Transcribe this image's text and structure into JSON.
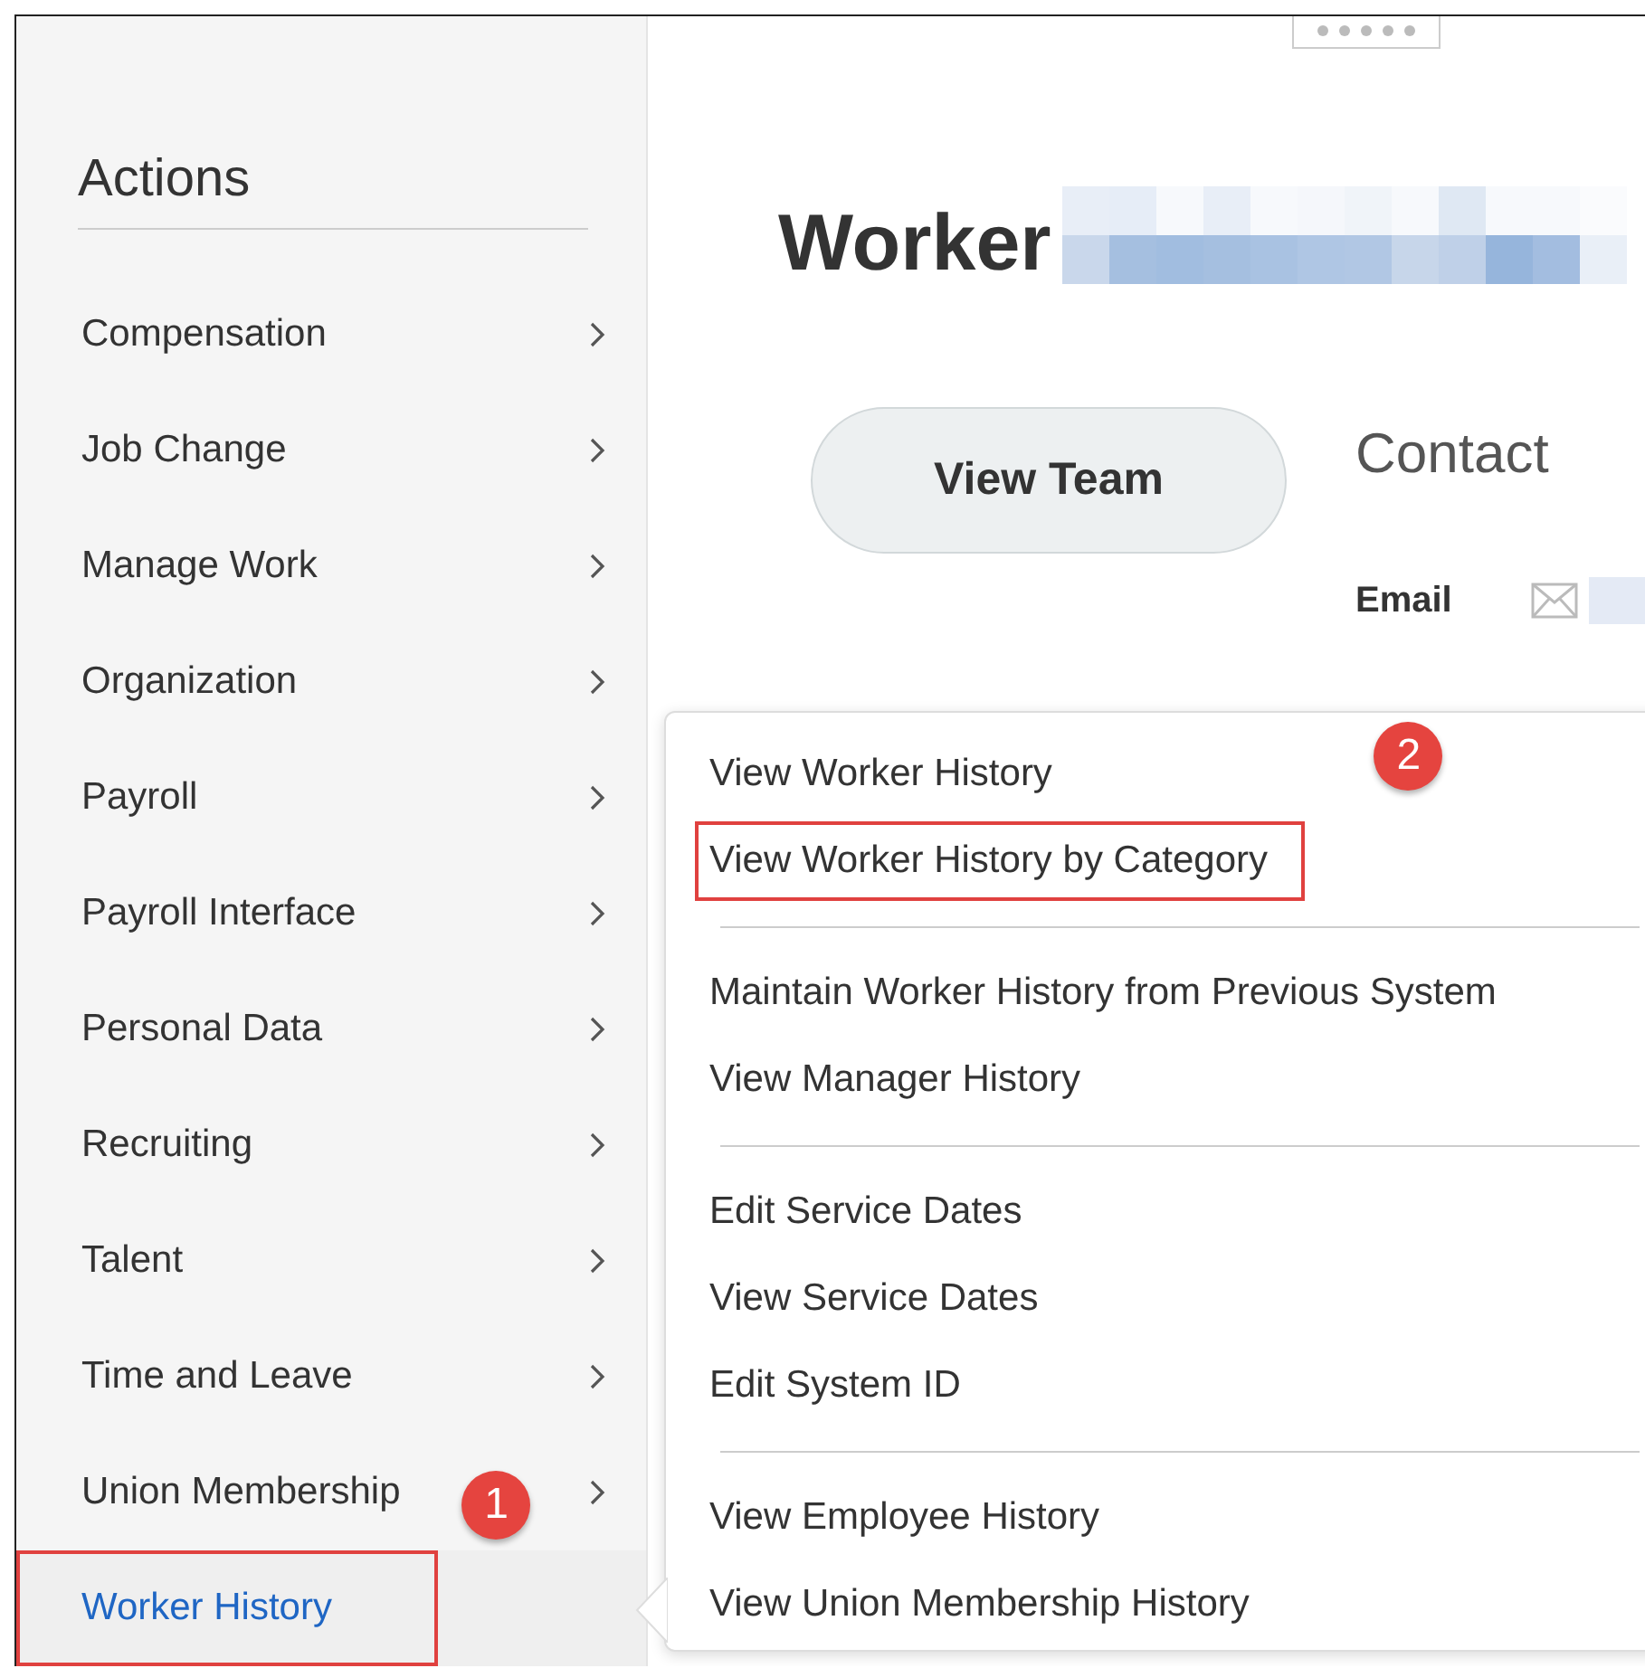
{
  "sidebar": {
    "title": "Actions",
    "items": [
      {
        "label": "Compensation",
        "selected": false,
        "highlighted": false
      },
      {
        "label": "Job Change",
        "selected": false,
        "highlighted": false
      },
      {
        "label": "Manage Work",
        "selected": false,
        "highlighted": false
      },
      {
        "label": "Organization",
        "selected": false,
        "highlighted": false
      },
      {
        "label": "Payroll",
        "selected": false,
        "highlighted": false
      },
      {
        "label": "Payroll Interface",
        "selected": false,
        "highlighted": false
      },
      {
        "label": "Personal Data",
        "selected": false,
        "highlighted": false
      },
      {
        "label": "Recruiting",
        "selected": false,
        "highlighted": false
      },
      {
        "label": "Talent",
        "selected": false,
        "highlighted": false
      },
      {
        "label": "Time and Leave",
        "selected": false,
        "highlighted": false
      },
      {
        "label": "Union Membership",
        "selected": false,
        "highlighted": false,
        "badge": "1"
      },
      {
        "label": "Worker History",
        "selected": true,
        "highlighted": true
      }
    ]
  },
  "header": {
    "title": "Worker",
    "button": "View Team"
  },
  "contact": {
    "title": "Contact",
    "email_label": "Email"
  },
  "submenu": {
    "groups": [
      [
        {
          "label": "View Worker History",
          "highlighted": false,
          "badge": "2"
        },
        {
          "label": "View Worker History by Category",
          "highlighted": true
        }
      ],
      [
        {
          "label": "Maintain Worker History from Previous System",
          "highlighted": false
        },
        {
          "label": "View Manager History",
          "highlighted": false
        }
      ],
      [
        {
          "label": "Edit Service Dates",
          "highlighted": false
        },
        {
          "label": "View Service Dates",
          "highlighted": false
        },
        {
          "label": "Edit System ID",
          "highlighted": false
        }
      ],
      [
        {
          "label": "View Employee History",
          "highlighted": false
        },
        {
          "label": "View Union Membership History",
          "highlighted": false
        }
      ]
    ]
  }
}
